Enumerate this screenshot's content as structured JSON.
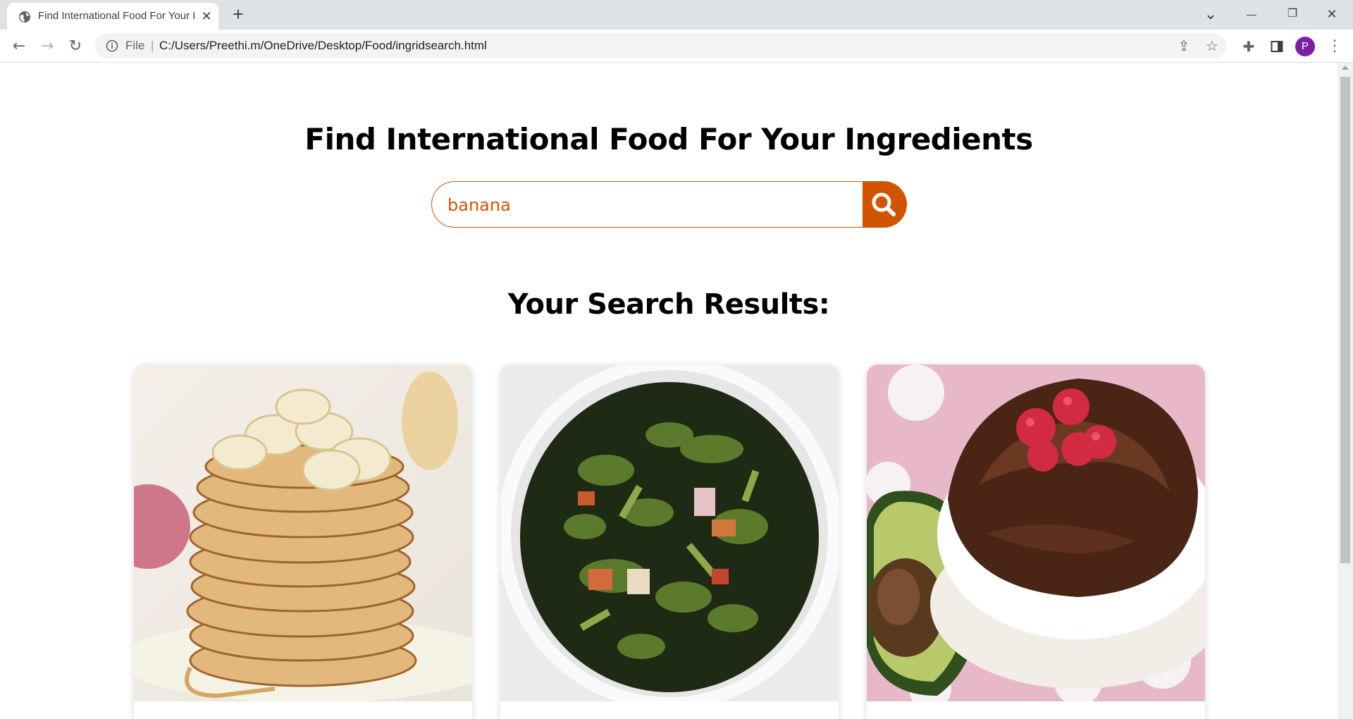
{
  "browser": {
    "tab_title": "Find International Food For Your Ingredients",
    "tab_close": "✕",
    "new_tab": "+",
    "file_label": "File",
    "separator": "|",
    "url": "C:/Users/Preethi.m/OneDrive/Desktop/Food/ingridsearch.html",
    "profile_initial": "P",
    "window_controls": {
      "minimize": "—",
      "restore": "❐",
      "close": "✕",
      "tab_search": "⌄"
    },
    "profile_color": "#7b1fa2"
  },
  "page": {
    "heading": "Find International Food For Your Ingredients",
    "search": {
      "value": "banana"
    },
    "results_heading": "Your Search Results:",
    "accent_color": "#d35400",
    "cards": [
      {
        "image": "banana-pancakes-image"
      },
      {
        "image": "collard-greens-image"
      },
      {
        "image": "chocolate-avocado-pudding-image"
      }
    ]
  }
}
